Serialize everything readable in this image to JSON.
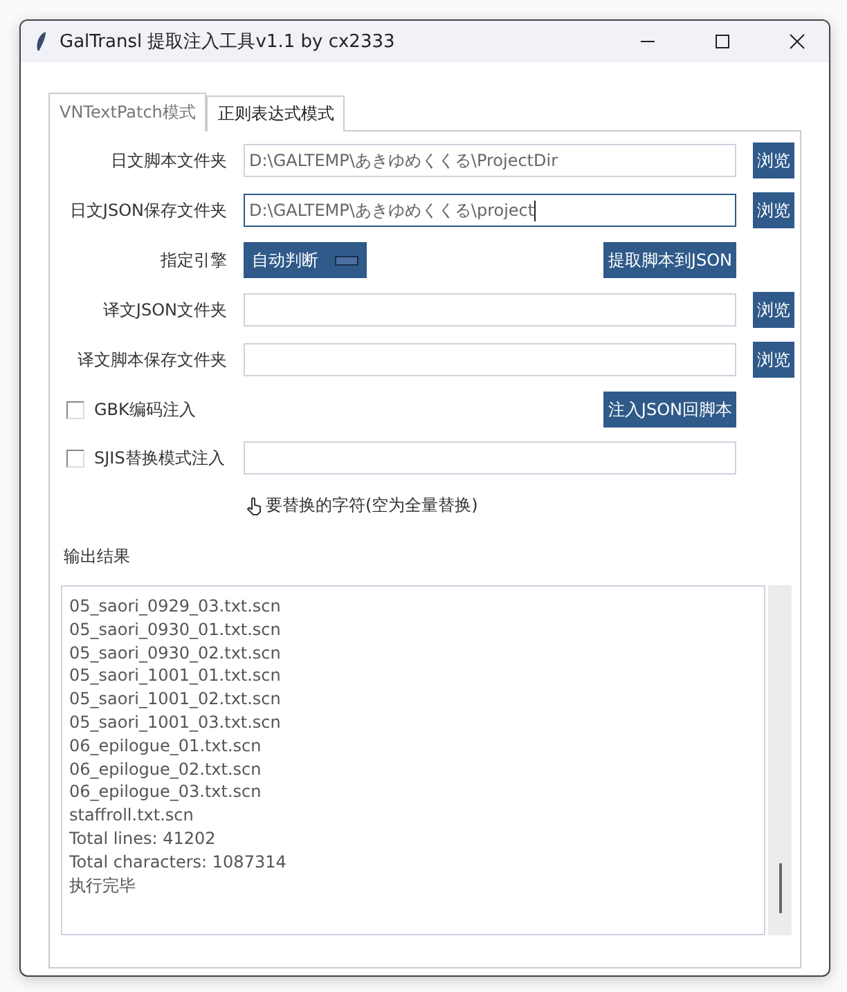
{
  "window": {
    "title": "GalTransl 提取注入工具v1.1 by cx2333"
  },
  "tabs": [
    {
      "label": "VNTextPatch模式",
      "selected": true
    },
    {
      "label": "正则表达式模式",
      "selected": false
    }
  ],
  "rows": [
    {
      "kind": "path",
      "label": "日文脚本文件夹",
      "value": "D:\\GALTEMP\\あきゆめくくる\\ProjectDir",
      "focused": false,
      "button": "浏览"
    },
    {
      "kind": "path",
      "label": "日文JSON保存文件夹",
      "value": "D:\\GALTEMP\\あきゆめくくる\\project",
      "focused": true,
      "button": "浏览"
    },
    {
      "kind": "engine",
      "label": "指定引擎",
      "value": "自动判断",
      "action": "提取脚本到JSON"
    },
    {
      "kind": "path",
      "label": "译文JSON文件夹",
      "focused": false,
      "button": "浏览"
    },
    {
      "kind": "path",
      "label": "译文脚本保存文件夹",
      "focused": false,
      "button": "浏览"
    },
    {
      "kind": "checkbox",
      "label": "GBK编码注入",
      "checked": false,
      "action": "注入JSON回脚本"
    },
    {
      "kind": "checkbox_field",
      "label": "SJIS替换模式注入",
      "checked": false
    }
  ],
  "hint": "要替换的字符(空为全量替换)",
  "output": {
    "label": "输出结果",
    "lines": [
      "05_saori_0929_03.txt.scn",
      "05_saori_0930_01.txt.scn",
      "05_saori_0930_02.txt.scn",
      "05_saori_1001_01.txt.scn",
      "05_saori_1001_02.txt.scn",
      "05_saori_1001_03.txt.scn",
      "06_epilogue_01.txt.scn",
      "06_epilogue_02.txt.scn",
      "06_epilogue_03.txt.scn",
      "staffroll.txt.scn",
      "Total lines: 41202",
      "Total characters: 1087314",
      "执行完毕"
    ]
  }
}
